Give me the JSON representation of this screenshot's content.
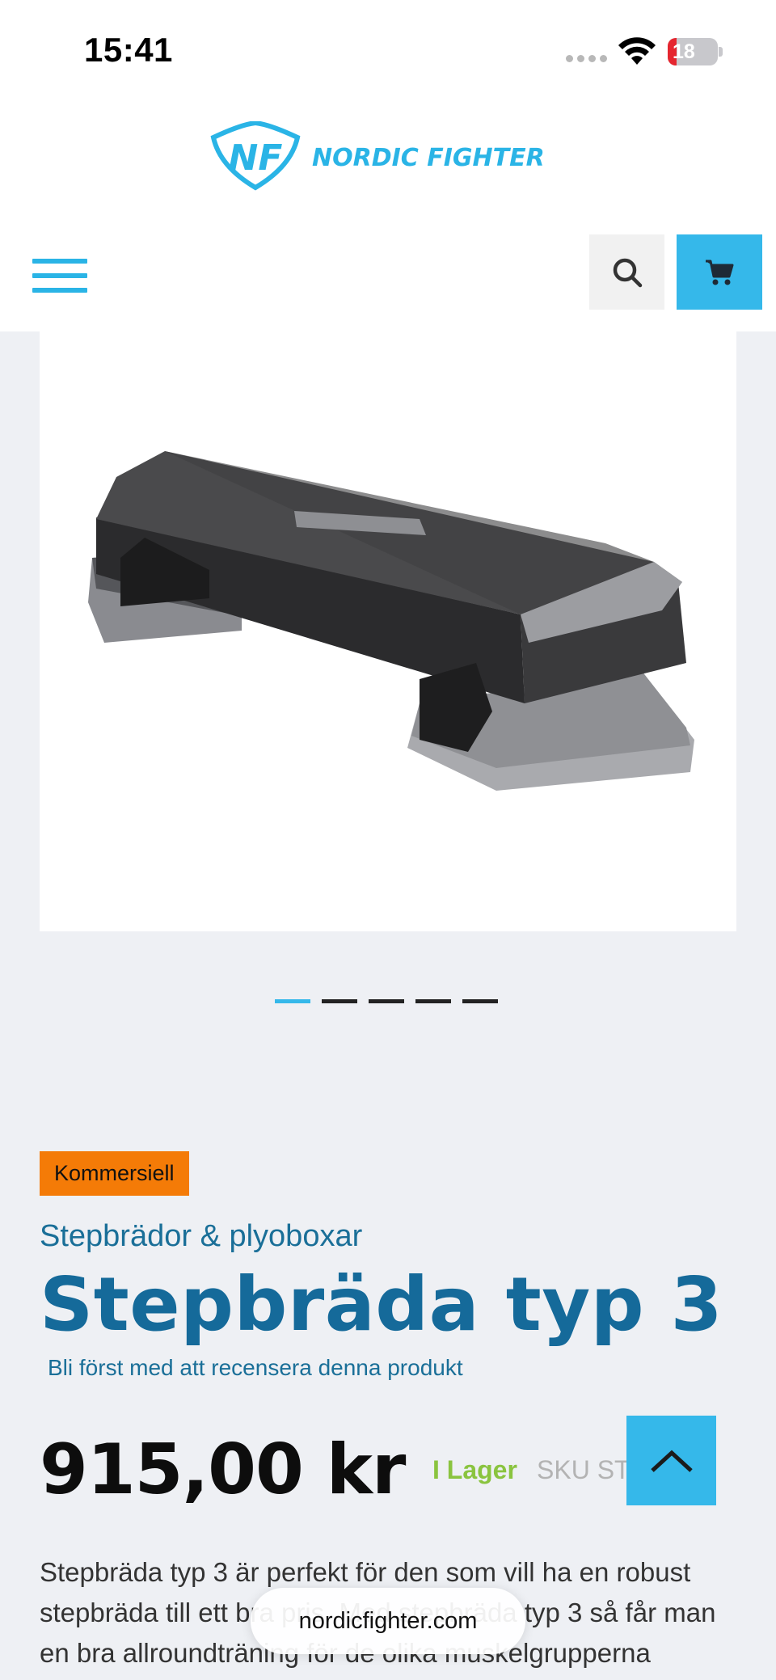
{
  "status_bar": {
    "time": "15:41",
    "battery_level": "18",
    "battery_color": "#e5262f"
  },
  "header": {
    "logo_text": "NORDIC FIGHTER",
    "logo_monogram": "NF",
    "brand_color": "#2ab4e6"
  },
  "product": {
    "image_alt": "Stepbräda typ 3",
    "carousel": {
      "total": 5,
      "active": 1
    },
    "badge": "Kommersiell",
    "category": "Stepbrädor & plyoboxar",
    "title": "Stepbräda typ 3",
    "review_link": "Bli först med att recensera denna produkt",
    "price": "915,00 kr",
    "stock": "I Lager",
    "sku": "SKU ST",
    "description": "Stepbräda typ 3 är perfekt för den som vill ha en robust stepbräda till ett bra pris. Med stepbräda typ 3 så får man en bra allroundträning för de olika muskelgrupperna"
  },
  "browser": {
    "url": "nordicfighter.com"
  }
}
